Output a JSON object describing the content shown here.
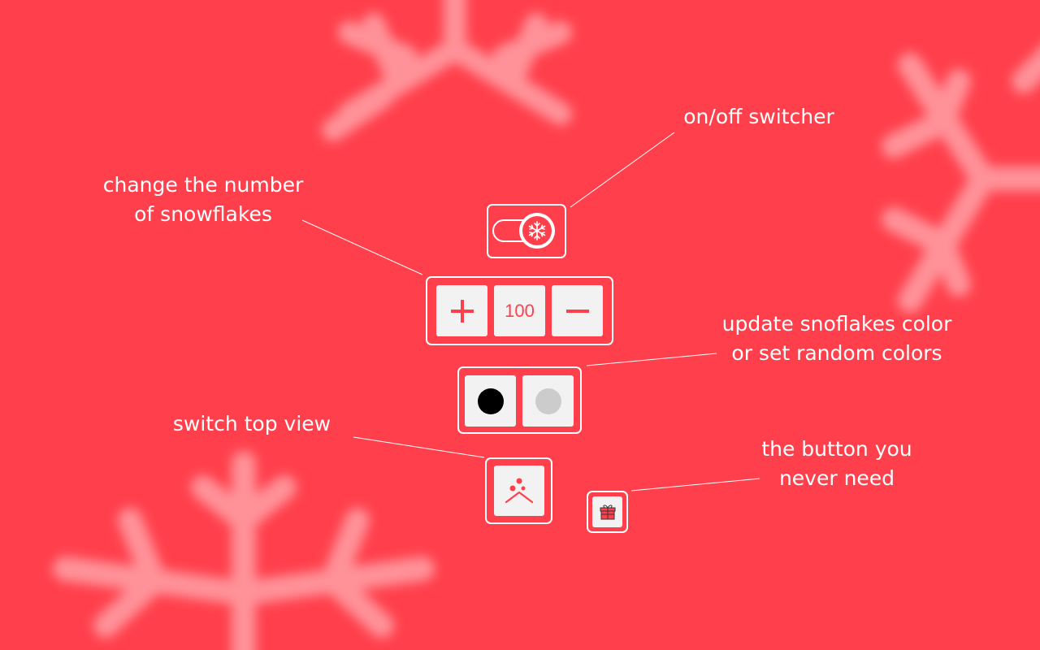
{
  "annotations": {
    "onoff": "on/off switcher",
    "number_line1": "change the number",
    "number_line2": "of snowflakes",
    "color_line1": "update snoflakes color",
    "color_line2": "or set random colors",
    "topview": "switch top view",
    "gift_line1": "the button you",
    "gift_line2": "never need"
  },
  "controls": {
    "snowflake_count": "100",
    "increase_icon": "plus-icon",
    "decrease_icon": "minus-icon",
    "toggle_icon": "snowflake-icon",
    "topview_icon": "top-view-icon",
    "gift_icon": "gift-icon",
    "color_swatch": "#000000",
    "random_color_swatch": "#cccccc"
  },
  "colors": {
    "background": "#ff404c",
    "accent": "#ff404c",
    "tile": "#f2f2f2",
    "frame": "#ffffff"
  }
}
